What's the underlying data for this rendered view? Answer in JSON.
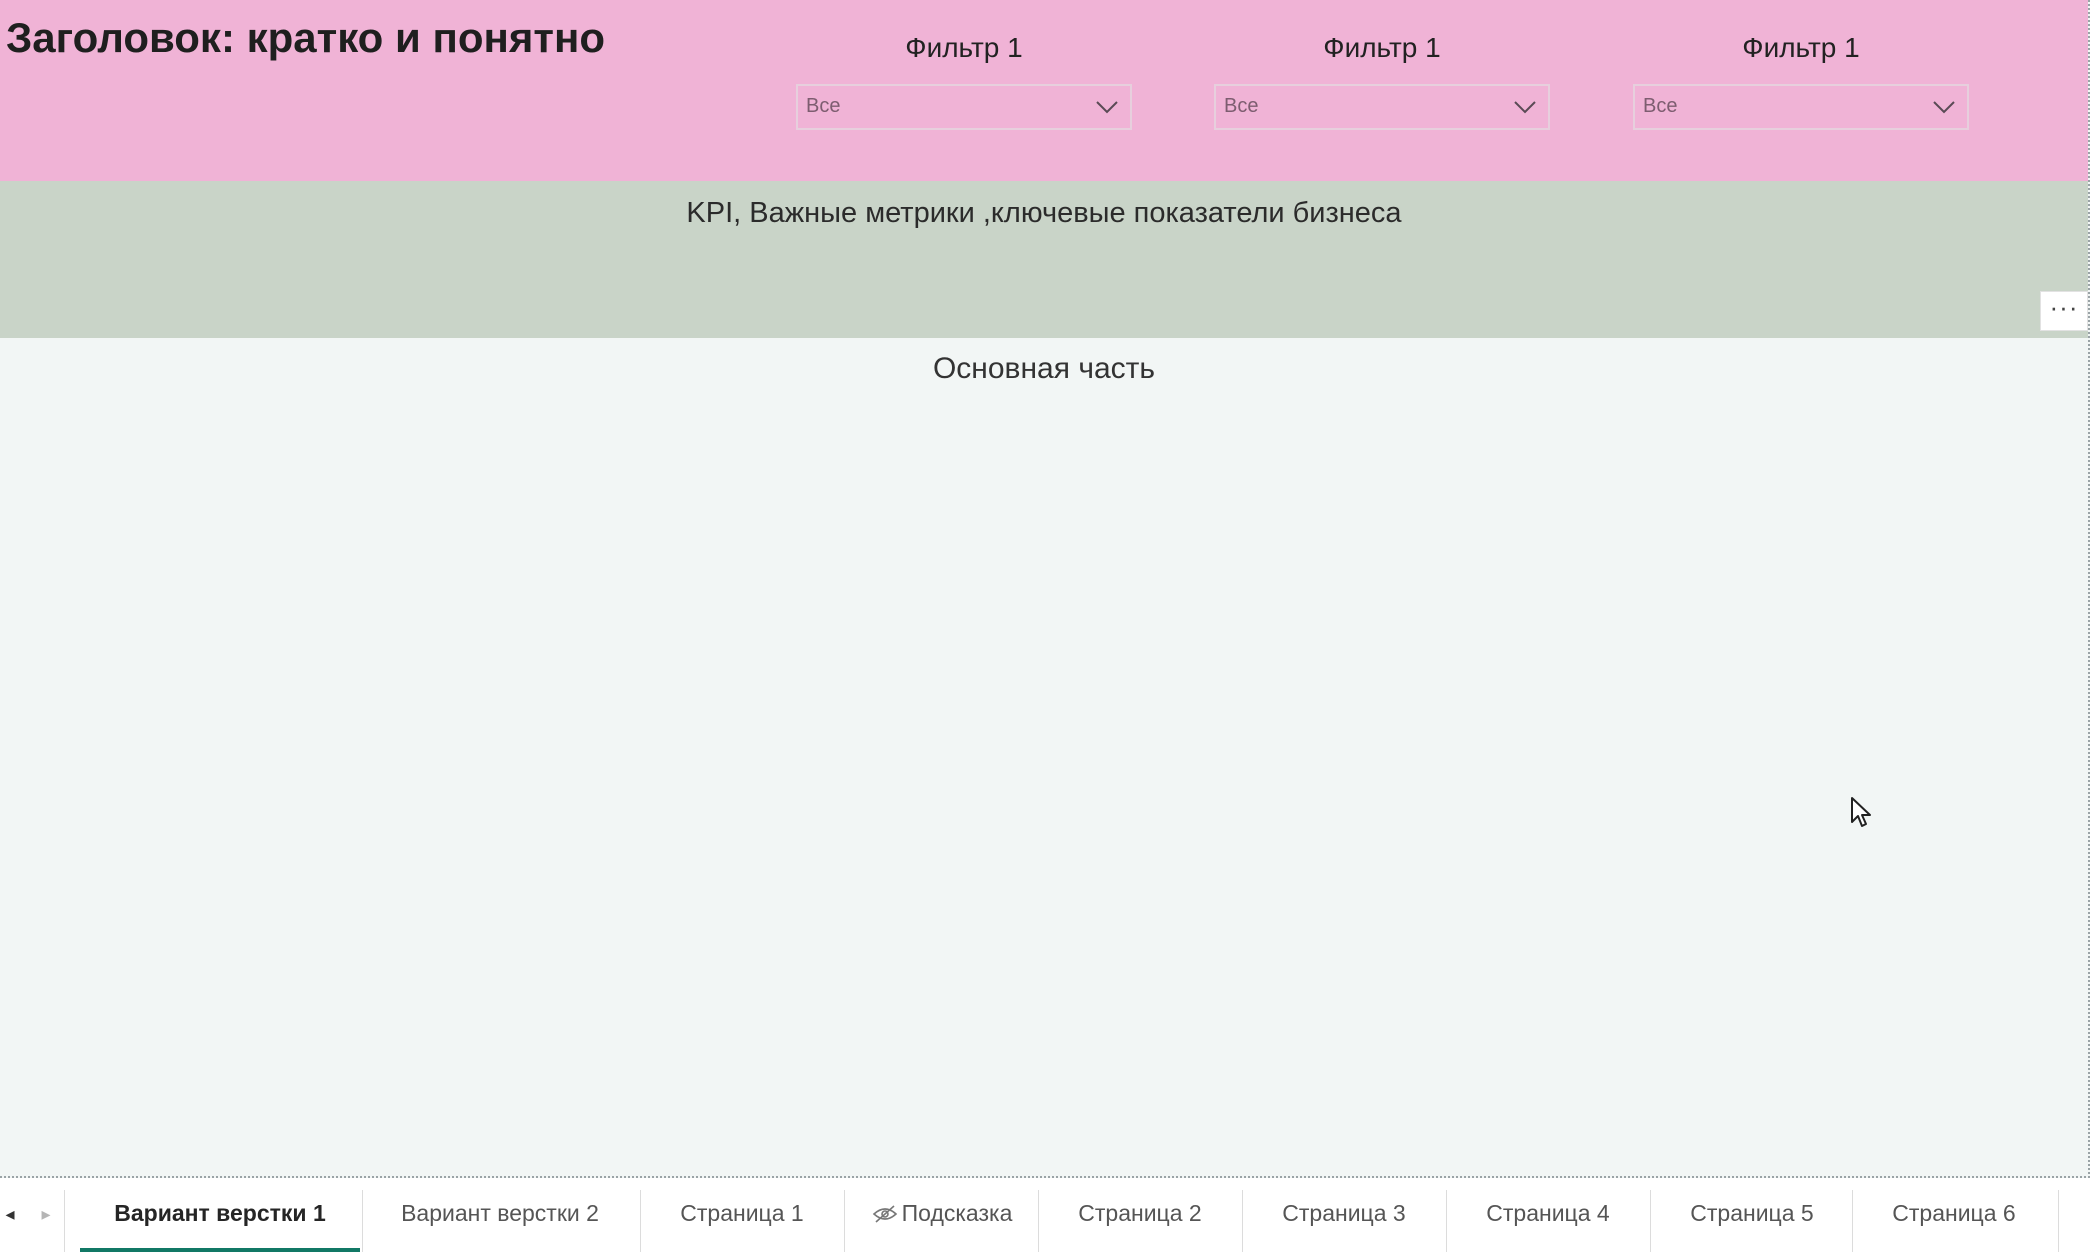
{
  "header": {
    "title": "Заголовок: кратко и понятно",
    "background": "#f0b3d6",
    "filters": [
      {
        "label": "Фильтр 1",
        "value": "Все"
      },
      {
        "label": "Фильтр 1",
        "value": "Все"
      },
      {
        "label": "Фильтр 1",
        "value": "Все"
      }
    ]
  },
  "kpi": {
    "text": "KPI, Важные метрики ,ключевые показатели бизнеса",
    "background": "#c9d4c8",
    "more_label": "···"
  },
  "main": {
    "title": "Основная часть",
    "background": "#f2f6f5"
  },
  "tabs": {
    "prev_label": "◂",
    "next_label": "▸",
    "items": [
      {
        "label": "Вариант верстки 1",
        "active": true
      },
      {
        "label": "Вариант верстки 2",
        "active": false
      },
      {
        "label": "Страница 1",
        "active": false
      },
      {
        "label": "Подсказка",
        "active": false,
        "icon": "hidden-eye-icon"
      },
      {
        "label": "Страница 2",
        "active": false
      },
      {
        "label": "Страница 3",
        "active": false
      },
      {
        "label": "Страница 4",
        "active": false
      },
      {
        "label": "Страница 5",
        "active": false
      },
      {
        "label": "Страница 6",
        "active": false
      }
    ],
    "accent": "#117865"
  }
}
